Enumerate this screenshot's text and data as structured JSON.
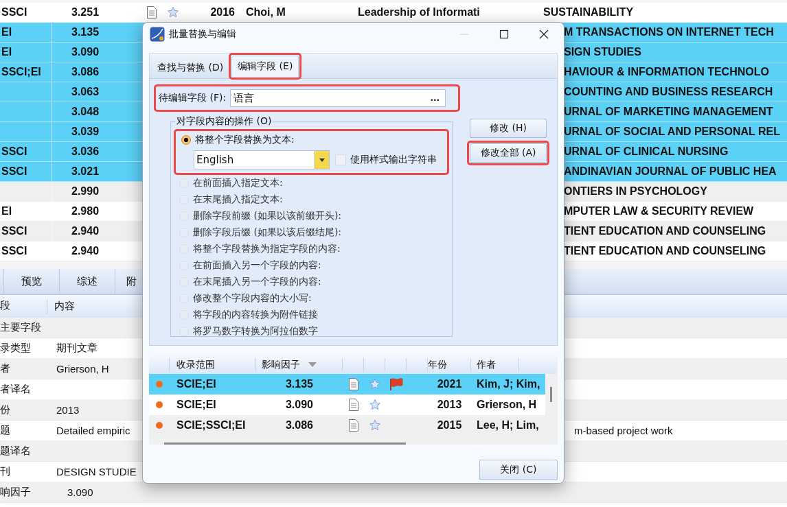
{
  "records_table": {
    "rows": [
      {
        "coverage": "SSCI",
        "impact": "3.251",
        "year": "2016",
        "author": "Choi, M",
        "title": "Leadership of Informati",
        "journal": "SUSTAINABILITY",
        "selected": false
      },
      {
        "coverage": "EI",
        "impact": "3.135",
        "journal": "M TRANSACTIONS ON INTERNET TECH",
        "selected": true
      },
      {
        "coverage": "EI",
        "impact": "3.090",
        "journal": "SIGN STUDIES",
        "selected": true
      },
      {
        "coverage": "SSCI;EI",
        "impact": "3.086",
        "journal": "HAVIOUR & INFORMATION TECHNOLO",
        "selected": true
      },
      {
        "coverage": "",
        "impact": "3.063",
        "journal": "COUNTING AND BUSINESS RESEARCH",
        "selected": true
      },
      {
        "coverage": "",
        "impact": "3.048",
        "journal": "URNAL OF MARKETING MANAGEMENT",
        "selected": true
      },
      {
        "coverage": "",
        "impact": "3.039",
        "journal": "URNAL OF SOCIAL AND PERSONAL REL",
        "selected": true
      },
      {
        "coverage": "SSCI",
        "impact": "3.036",
        "journal": "URNAL OF CLINICAL NURSING",
        "selected": true
      },
      {
        "coverage": "SSCI",
        "impact": "3.021",
        "journal": "ANDINAVIAN JOURNAL OF PUBLIC HEA",
        "selected": true
      },
      {
        "coverage": "",
        "impact": "2.990",
        "journal": "ONTIERS IN PSYCHOLOGY",
        "selected": false
      },
      {
        "coverage": "EI",
        "impact": "2.980",
        "journal": "MPUTER LAW & SECURITY REVIEW",
        "selected": false
      },
      {
        "coverage": "SSCI",
        "impact": "2.940",
        "journal": "TIENT EDUCATION AND COUNSELING",
        "selected": false
      },
      {
        "coverage": "SSCI",
        "impact": "2.940",
        "journal": "TIENT EDUCATION AND COUNSELING",
        "selected": false
      }
    ]
  },
  "detail_panel": {
    "tabs": [
      "预览",
      "综述",
      "附"
    ],
    "columns": [
      "段",
      "内容"
    ],
    "rows": [
      {
        "field": "主要字段"
      },
      {
        "field": "录类型",
        "value": "期刊文章"
      },
      {
        "field": "者",
        "value": "Grierson, H"
      },
      {
        "field": "者译名"
      },
      {
        "field": "份",
        "value": "2013"
      },
      {
        "field": "题",
        "value": "Detailed empiric",
        "value_continued": "m-based project work"
      },
      {
        "field": "题译名"
      },
      {
        "field": "刊",
        "value": "DESIGN STUDIE"
      },
      {
        "field": "响因子",
        "value": "3.090",
        "kind": "number"
      }
    ]
  },
  "dialog": {
    "title": "批量替换与编辑",
    "tabs": [
      {
        "label": "查找与替换 (D)",
        "selected": false,
        "highlighted": false
      },
      {
        "label": "编辑字段 (E)",
        "selected": true,
        "highlighted": true
      }
    ],
    "field": {
      "label": "待编辑字段 (F):",
      "value": "语言",
      "browse": "...",
      "highlighted": true
    },
    "operations": {
      "legend": "对字段内容的操作 (O)",
      "options": [
        {
          "label": "将整个字段替换为文本:",
          "selected": true,
          "highlighted": true,
          "combo": {
            "value": "English"
          },
          "checkbox": {
            "label": "使用样式输出字符串",
            "checked": false
          }
        },
        {
          "label": "在前面插入指定文本:",
          "selected": false
        },
        {
          "label": "在末尾插入指定文本:",
          "selected": false
        },
        {
          "label": "删除字段前缀 (如果以该前缀开头):",
          "selected": false
        },
        {
          "label": "删除字段后缀 (如果以该后缀结尾):",
          "selected": false
        },
        {
          "label": "将整个字段替换为指定字段的内容:",
          "selected": false
        },
        {
          "label": "在前面插入另一个字段的内容:",
          "selected": false
        },
        {
          "label": "在末尾插入另一个字段的内容:",
          "selected": false
        },
        {
          "label": "修改整个字段内容的大小写:",
          "selected": false
        },
        {
          "label": "将字段的内容转换为附件链接",
          "selected": false
        },
        {
          "label": "将罗马数字转换为阿拉伯数字",
          "selected": false
        }
      ]
    },
    "buttons": [
      {
        "label": "修改 (H)",
        "highlighted": false
      },
      {
        "label": "修改全部 (A)",
        "highlighted": true
      }
    ],
    "table": {
      "columns": [
        "收录范围",
        "影响因子",
        "年份",
        "作者"
      ],
      "rows": [
        {
          "coverage": "SCIE;EI",
          "impact": "3.135",
          "flagged": true,
          "year": "2021",
          "author": "Kim, J; Kim,",
          "selected": true
        },
        {
          "coverage": "SCIE;EI",
          "impact": "3.090",
          "flagged": false,
          "year": "2013",
          "author": "Grierson, H",
          "selected": false
        },
        {
          "coverage": "SCIE;SSCI;EI",
          "impact": "3.086",
          "flagged": false,
          "year": "2015",
          "author": "Lee, H; Lim,",
          "selected": false
        }
      ]
    },
    "close_button": "关闭 (C)"
  }
}
